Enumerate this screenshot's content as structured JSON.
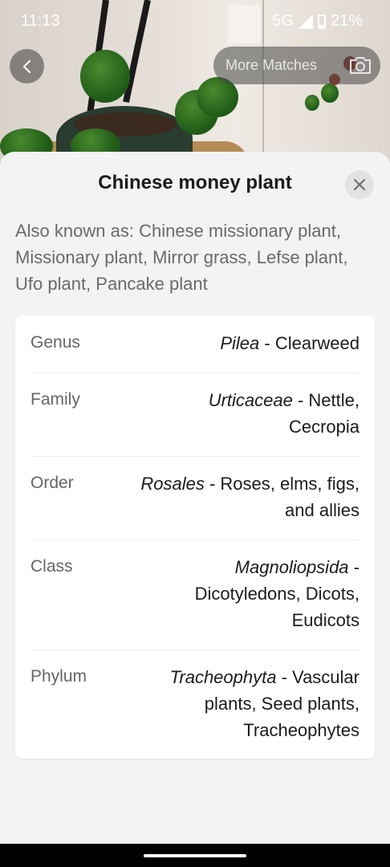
{
  "status": {
    "time": "11:13",
    "network": "5G",
    "battery": "21%",
    "battery_level": 0.21
  },
  "top": {
    "more_matches_label": "More Matches",
    "back_icon": "back-arrow-icon",
    "camera_icon": "camera-icon"
  },
  "sheet": {
    "title": "Chinese money plant",
    "close_icon": "close-icon",
    "also_known_as": "Also known as: Chinese missionary plant, Missionary plant, Mirror grass, Lefse plant, Ufo plant, Pancake plant"
  },
  "taxonomy": [
    {
      "label": "Genus",
      "sci": "Pilea",
      "common": " - Clearweed"
    },
    {
      "label": "Family",
      "sci": "Urticaceae",
      "common": " - Nettle, Cecropia"
    },
    {
      "label": "Order",
      "sci": "Rosales",
      "common": " - Roses, elms, figs, and allies"
    },
    {
      "label": "Class",
      "sci": "Magnoliopsida",
      "common": " - Dicotyledons, Dicots, Eudicots"
    },
    {
      "label": "Phylum",
      "sci": "Tracheophyta",
      "common": " - Vascular plants, Seed plants, Tracheophytes"
    }
  ]
}
